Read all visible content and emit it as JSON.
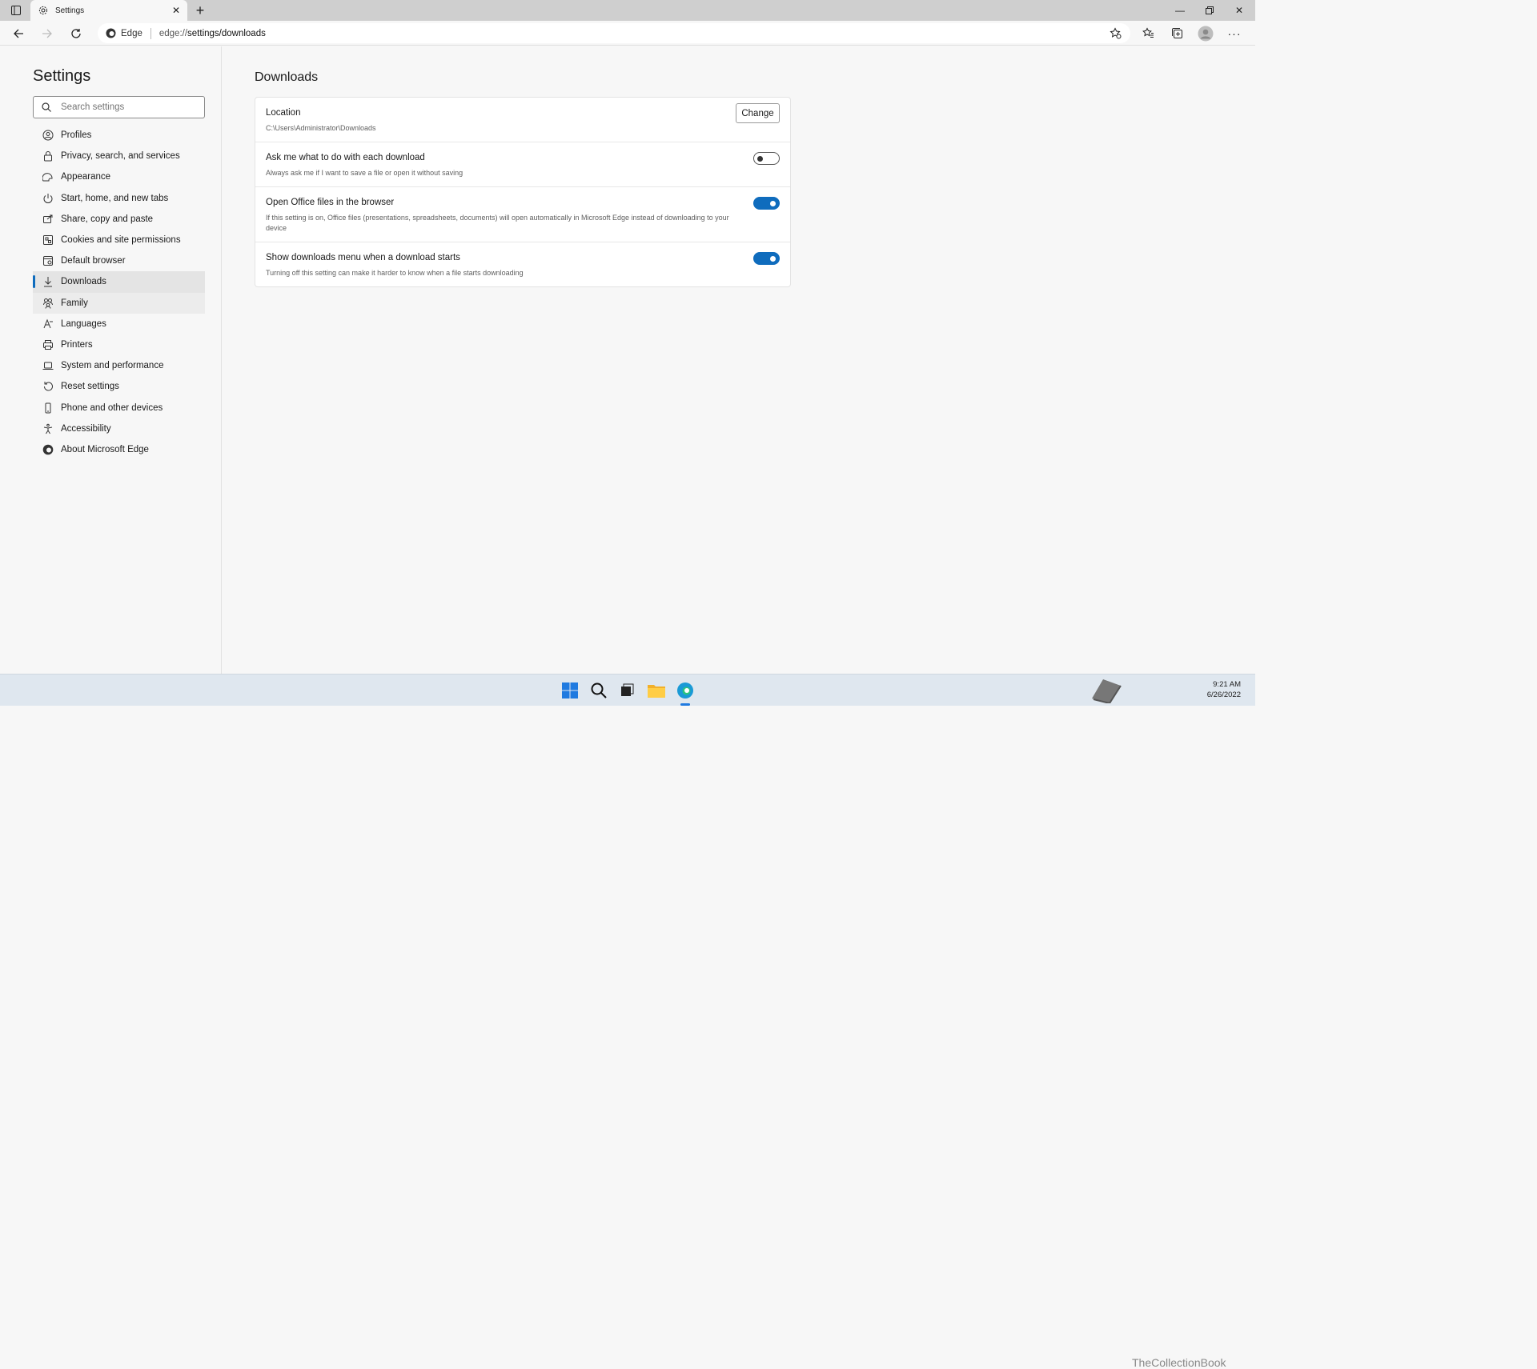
{
  "browser": {
    "tab_title": "Settings",
    "site_label": "Edge",
    "url_prefix": "edge://",
    "url_path": "settings/downloads"
  },
  "sidebar": {
    "title": "Settings",
    "search_placeholder": "Search settings",
    "items": [
      {
        "label": "Profiles",
        "icon": "profile-icon"
      },
      {
        "label": "Privacy, search, and services",
        "icon": "lock-icon"
      },
      {
        "label": "Appearance",
        "icon": "appearance-icon"
      },
      {
        "label": "Start, home, and new tabs",
        "icon": "power-icon"
      },
      {
        "label": "Share, copy and paste",
        "icon": "share-icon"
      },
      {
        "label": "Cookies and site permissions",
        "icon": "cookies-icon"
      },
      {
        "label": "Default browser",
        "icon": "browser-icon"
      },
      {
        "label": "Downloads",
        "icon": "download-icon"
      },
      {
        "label": "Family",
        "icon": "family-icon"
      },
      {
        "label": "Languages",
        "icon": "languages-icon"
      },
      {
        "label": "Printers",
        "icon": "printer-icon"
      },
      {
        "label": "System and performance",
        "icon": "laptop-icon"
      },
      {
        "label": "Reset settings",
        "icon": "reset-icon"
      },
      {
        "label": "Phone and other devices",
        "icon": "phone-icon"
      },
      {
        "label": "Accessibility",
        "icon": "accessibility-icon"
      },
      {
        "label": "About Microsoft Edge",
        "icon": "edge-icon"
      }
    ],
    "active_item": "Downloads"
  },
  "main": {
    "title": "Downloads",
    "location": {
      "title": "Location",
      "path": "C:\\Users\\Administrator\\Downloads",
      "button_label": "Change"
    },
    "settings": [
      {
        "title": "Ask me what to do with each download",
        "desc": "Always ask me if I want to save a file or open it without saving",
        "enabled": false
      },
      {
        "title": "Open Office files in the browser",
        "desc": "If this setting is on, Office files (presentations, spreadsheets, documents) will open automatically in Microsoft Edge instead of downloading to your device",
        "enabled": true
      },
      {
        "title": "Show downloads menu when a download starts",
        "desc": "Turning off this setting can make it harder to know when a file starts downloading",
        "enabled": true
      }
    ]
  },
  "taskbar": {
    "time": "9:21 AM",
    "date": "6/26/2022",
    "watermark": "TheCollectionBook"
  },
  "colors": {
    "accent": "#0f6cbd",
    "chrome_bg": "#f7f7f7",
    "taskbar_bg": "#dfe7ef"
  }
}
